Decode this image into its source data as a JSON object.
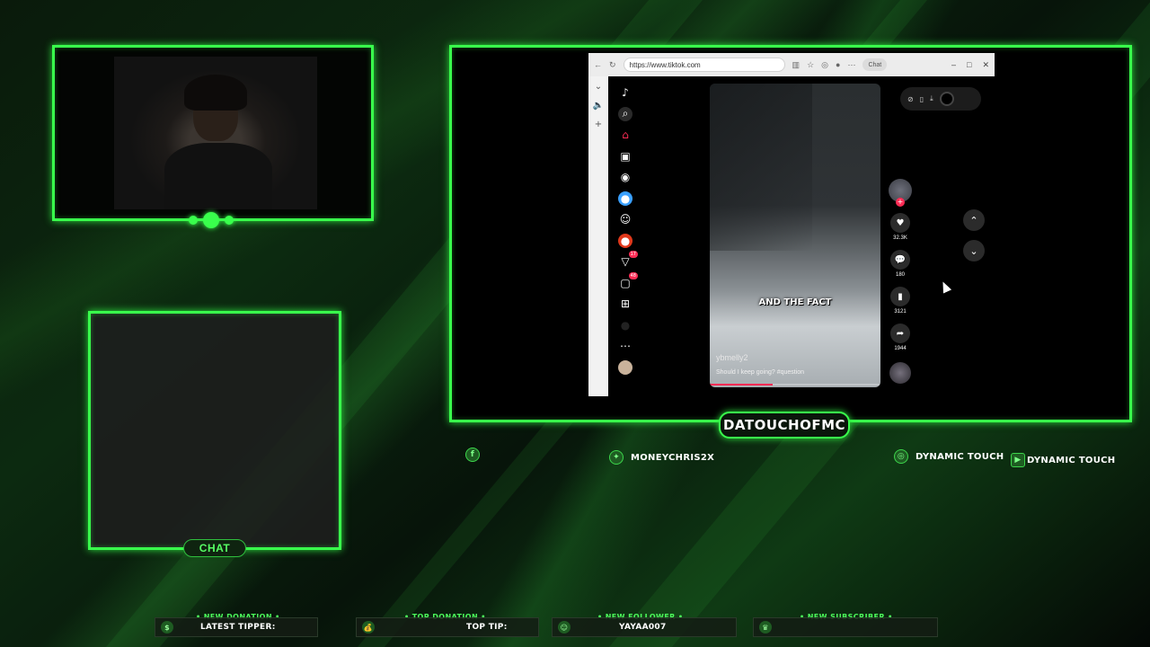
{
  "overlay": {
    "channel_name": "DATOUCHOFMC",
    "chat_label": "CHAT",
    "accent_color": "#39ff4c"
  },
  "socials": [
    {
      "icon": "facebook-icon",
      "handle": ""
    },
    {
      "icon": "twitter-icon",
      "handle": "MONEYCHRIS2X"
    },
    {
      "icon": "instagram-icon",
      "handle": "DYNAMIC TOUCH"
    },
    {
      "icon": "youtube-icon",
      "handle": "DYNAMIC TOUCH"
    }
  ],
  "alerts": [
    {
      "title": "NEW DONATION",
      "text": "LATEST TIPPER:",
      "icon": "donation-icon"
    },
    {
      "title": "TOP DONATION",
      "text": "TOP TIP:",
      "icon": "money-bag-icon"
    },
    {
      "title": "NEW FOLLOWER",
      "text": "YAYAA007",
      "icon": "user-icon"
    },
    {
      "title": "NEW SUBSCRIBER",
      "text": "",
      "icon": "crown-icon"
    }
  ],
  "browser": {
    "url": "https://www.tiktok.com",
    "chat_pill": "Chat"
  },
  "tiktok": {
    "sidebar_badges": {
      "inbox": "17",
      "activity": "48"
    },
    "video": {
      "caption": "AND THE FACT",
      "username": "ybmelly2",
      "description": "Should I keep going? #question",
      "progress": 0.37
    },
    "actions": {
      "likes": "32.3K",
      "comments": "180",
      "saves": "3121",
      "shares": "1944"
    }
  }
}
